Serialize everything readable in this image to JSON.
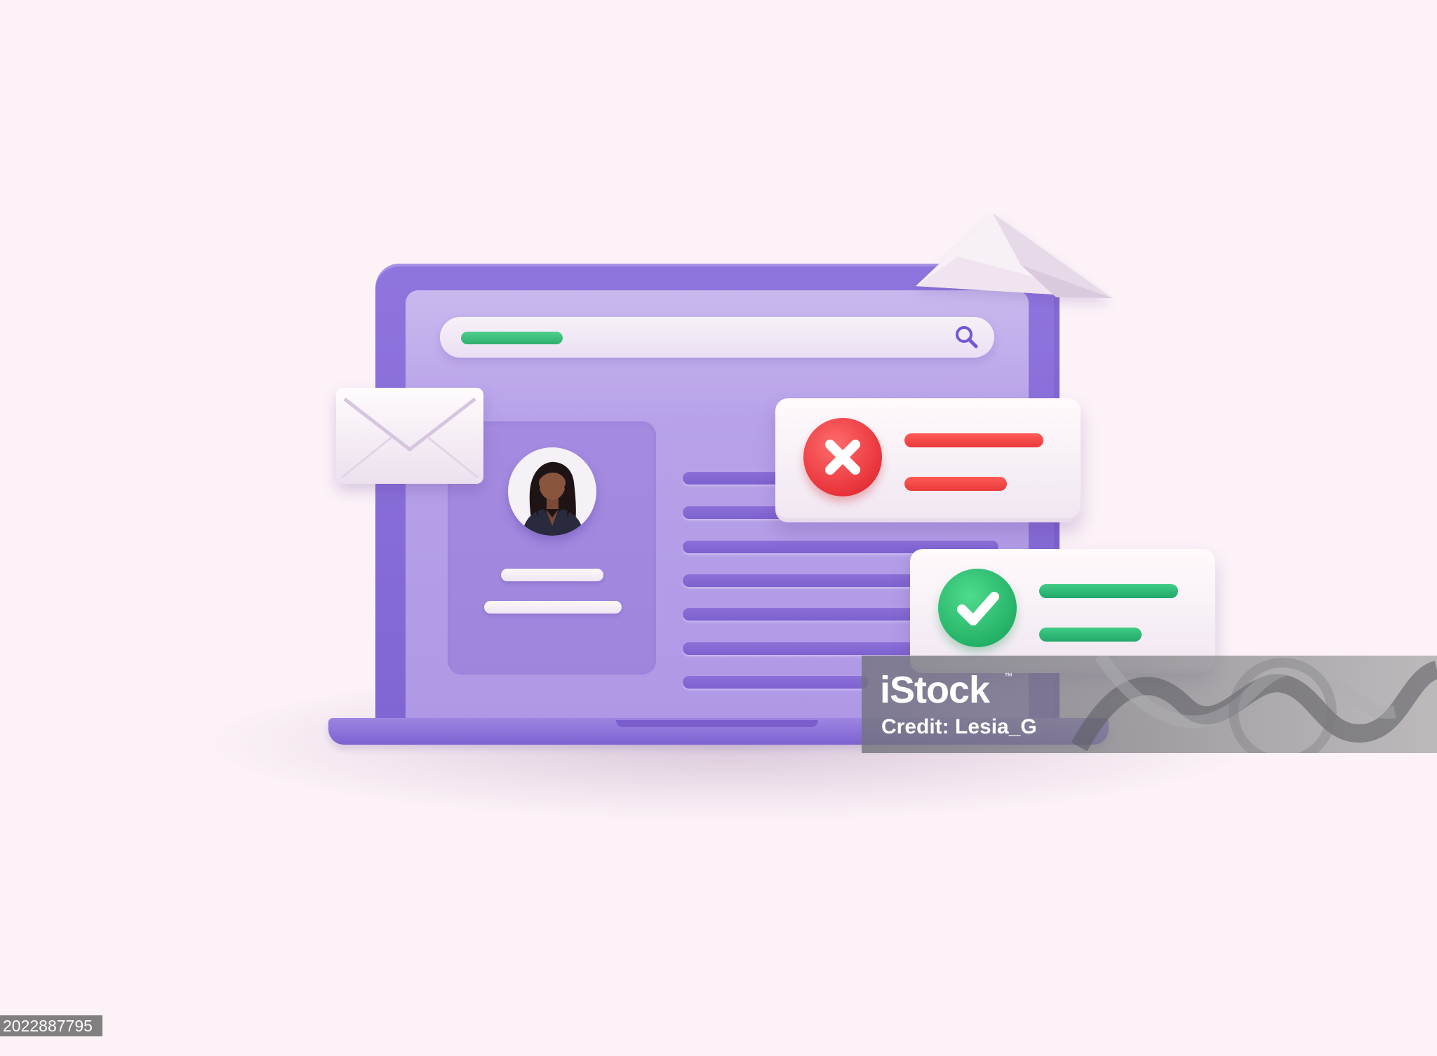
{
  "colors": {
    "background": "#FCF2F8",
    "laptop": "#8066D2",
    "screen": "#B7A2E9",
    "accent_green": "#2FAE6E",
    "accent_red": "#E8333A",
    "card": "#F6EEF5"
  },
  "search": {
    "icon": "magnifier-icon"
  },
  "profile": {
    "avatar_icon": "user-avatar-icon"
  },
  "notifications": [
    {
      "status": "error",
      "icon": "cross-icon",
      "color": "#E8333A"
    },
    {
      "status": "success",
      "icon": "check-icon",
      "color": "#25B267"
    }
  ],
  "decorations": {
    "envelope_icon": "envelope-icon",
    "plane_icon": "paper-plane-icon"
  },
  "watermark": {
    "brand": "iStock",
    "trademark": "™",
    "credit": "Credit: Lesia_G"
  },
  "image_id": "2022887795"
}
